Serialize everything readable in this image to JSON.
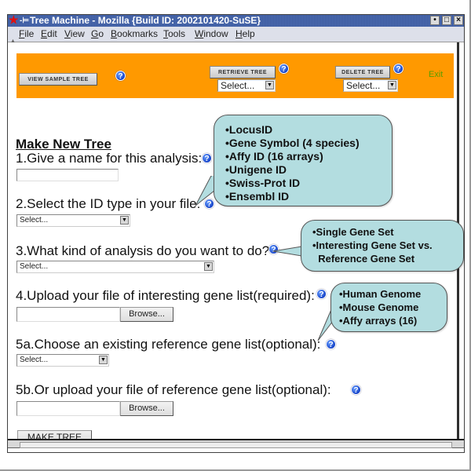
{
  "window": {
    "title": "Tree Machine - Mozilla {Build ID: 2002101420-SuSE}",
    "controls": {
      "minimize": "•",
      "maximize": "□",
      "close": "×"
    }
  },
  "menu": [
    {
      "label": "File",
      "mnemonic": "F",
      "rest": "ile"
    },
    {
      "label": "Edit",
      "mnemonic": "E",
      "rest": "dit"
    },
    {
      "label": "View",
      "mnemonic": "V",
      "rest": "iew"
    },
    {
      "label": "Go",
      "mnemonic": "G",
      "rest": "o"
    },
    {
      "label": "Bookmarks",
      "mnemonic": "B",
      "rest": "ookmarks"
    },
    {
      "label": "Tools",
      "mnemonic": "T",
      "rest": "ools"
    },
    {
      "label": "Window",
      "mnemonic": "W",
      "rest": "indow"
    },
    {
      "label": "Help",
      "mnemonic": "H",
      "rest": "elp"
    }
  ],
  "toolbar": {
    "view_sample_tree": "VIEW SAMPLE TREE",
    "retrieve_tree": "RETRIEVE TREE",
    "retrieve_select": "Select...",
    "delete_tree": "DELETE TREE",
    "delete_select": "Select...",
    "exit": "Exit",
    "help_glyph": "?",
    "accent_color": "#ff9900"
  },
  "form": {
    "heading": "Make New Tree",
    "q1": "1.Give a name for this analysis:",
    "q1_value": "",
    "q2": "2.Select the ID type in your file:",
    "q2_select": "Select...",
    "q3": "3.What kind of analysis do you want to do?",
    "q3_select": "Select...",
    "q4": "4.Upload your file of interesting gene list(required):",
    "q4_value": "",
    "q4_browse": "Browse...",
    "q5a": "5a.Choose an existing reference gene list(optional):",
    "q5a_select": "Select...",
    "q5b": "5b.Or upload your file of reference gene list(optional):",
    "q5b_value": "",
    "q5b_browse": "Browse...",
    "make_tree": "MAKE TREE"
  },
  "callouts": {
    "id_types": [
      "•LocusID",
      "•Gene Symbol (4 species)",
      "•Affy ID (16 arrays)",
      "•Unigene ID",
      "•Swiss-Prot ID",
      "•Ensembl ID"
    ],
    "analysis_types": [
      "•Single Gene Set",
      "•Interesting Gene Set vs.",
      "  Reference Gene Set"
    ],
    "reference_lists": [
      "•Human Genome",
      "•Mouse Genome",
      "•Affy arrays (16)"
    ],
    "bubble_color": "#b3dde0"
  }
}
